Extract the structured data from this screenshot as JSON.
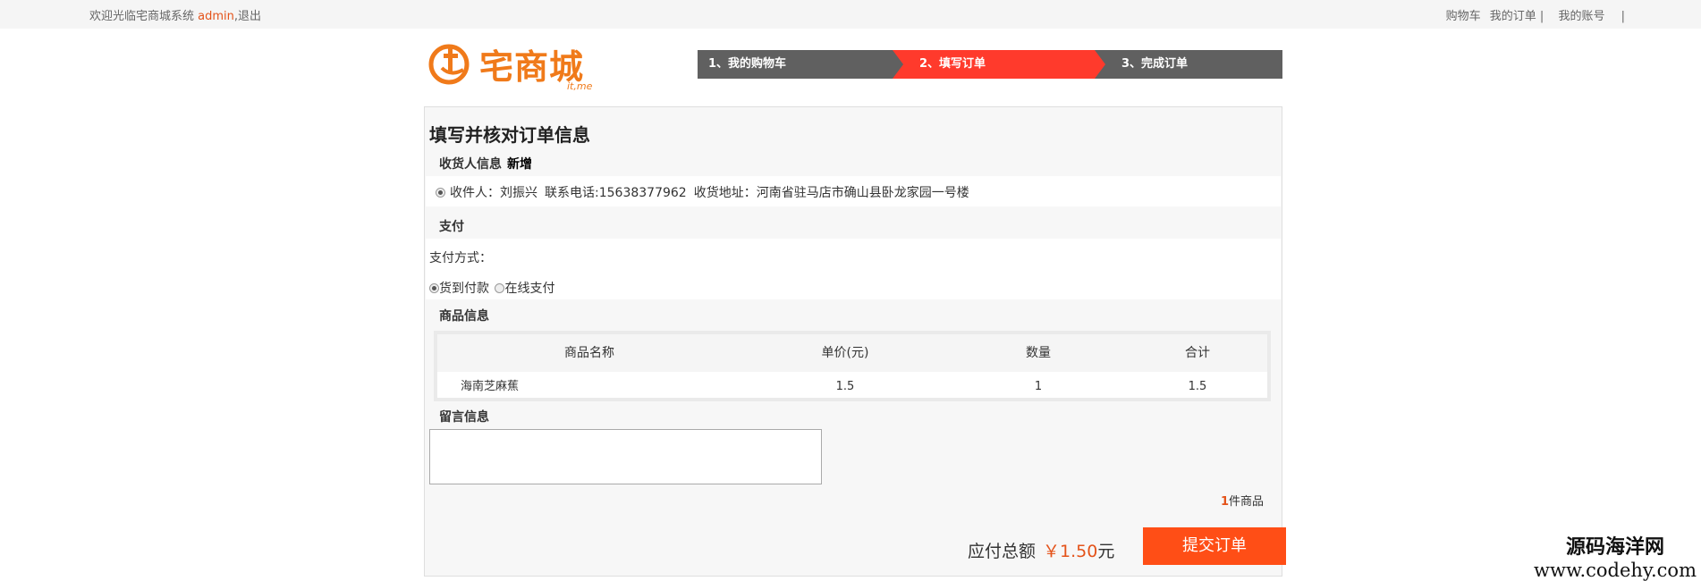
{
  "topbar": {
    "welcome": "欢迎光临宅商城系统",
    "username": "admin",
    "logout": ",退出",
    "links": [
      "购物车",
      "我的订单 |",
      "我的账号",
      "|"
    ]
  },
  "logo": {
    "text": "宅商城",
    "sub": "it,me"
  },
  "steps": [
    "1、我的购物车",
    "2、填写订单",
    "3、完成订单"
  ],
  "page": {
    "title": "填写并核对订单信息",
    "receiver_section": "收货人信息",
    "add_new": "新增",
    "address": {
      "receiver": "收件人：刘振兴",
      "phone": "联系电话:15638377962",
      "addr": "收货地址：河南省驻马店市确山县卧龙家园一号楼"
    },
    "pay_section": "支付",
    "pay_label": "支付方式：",
    "pay_options": [
      "货到付款",
      "在线支付"
    ],
    "pay_selected": "货到付款",
    "goods_section": "商品信息",
    "table": {
      "headers": [
        "商品名称",
        "单价(元)",
        "数量",
        "合计"
      ],
      "rows": [
        [
          "海南芝麻蕉",
          "1.5",
          "1",
          "1.5"
        ]
      ]
    },
    "message_section": "留言信息",
    "count": "1",
    "count_suffix": "件商品",
    "total_label": "应付总额",
    "total_value": "￥1.50",
    "total_unit": "元",
    "submit": "提交订单"
  },
  "watermark": {
    "line1": "源码海洋网",
    "line2": "www.codehy.com"
  },
  "colors": {
    "accent": "#ff3a2c",
    "orange": "#e4531a",
    "step_gray": "#606060"
  }
}
